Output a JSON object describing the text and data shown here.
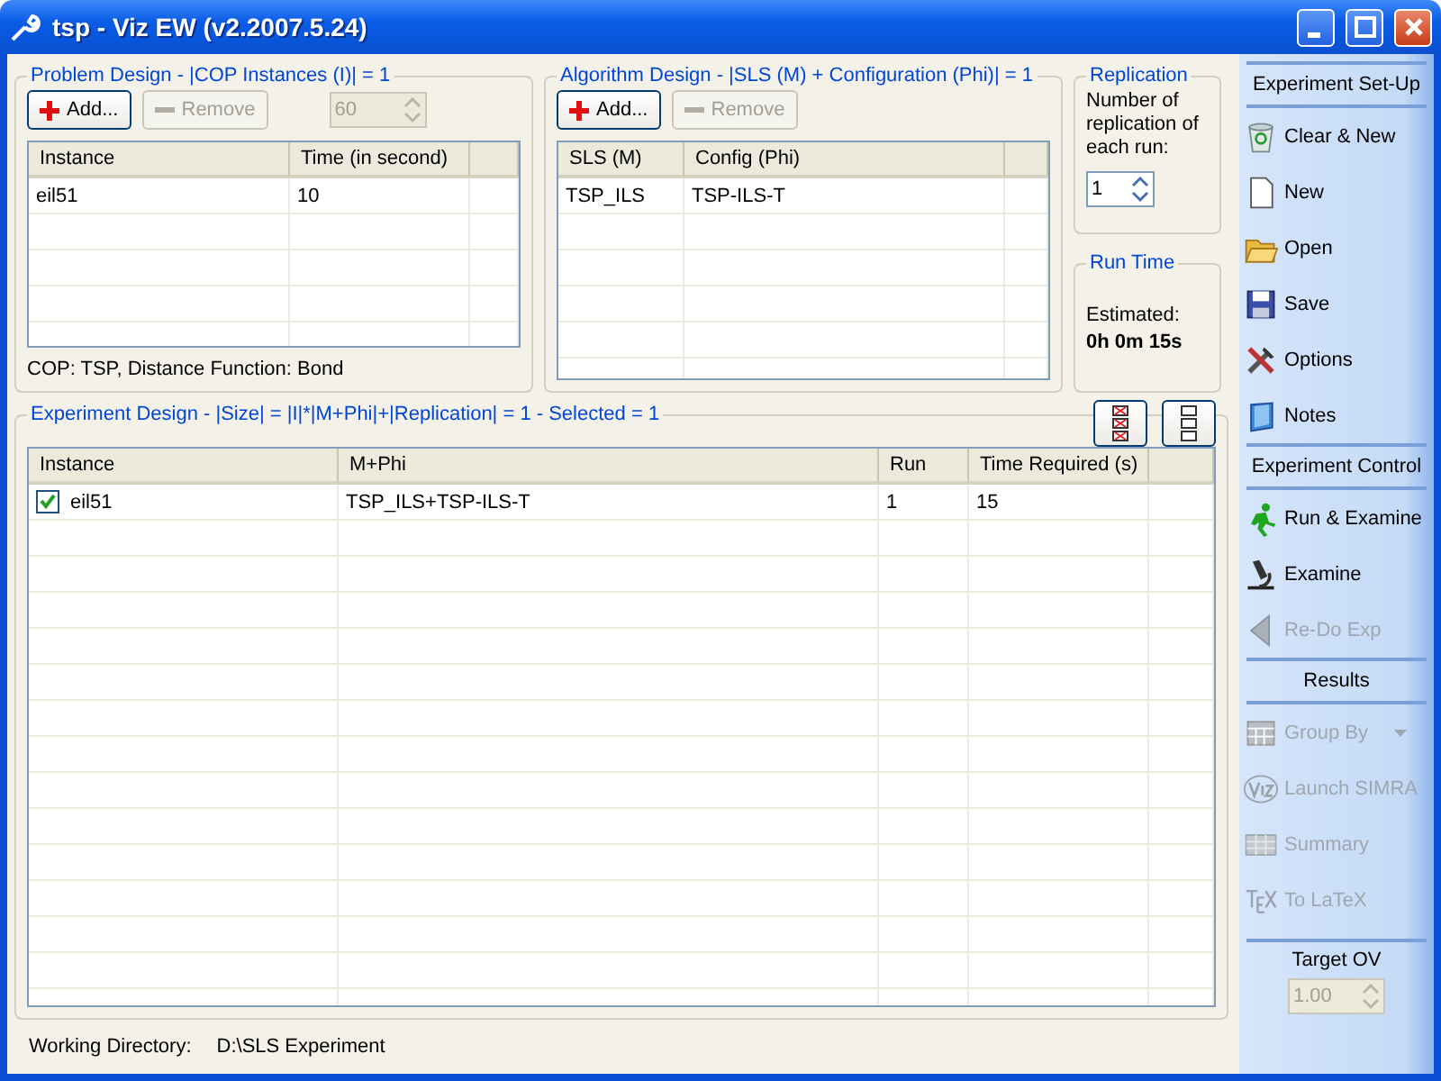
{
  "window": {
    "title": "tsp - Viz EW (v2.2007.5.24)"
  },
  "problem_design": {
    "title": "Problem Design - |COP Instances (I)| = 1",
    "add_button": "Add...",
    "remove_button": {
      "label": "Remove",
      "disabled": true
    },
    "spinner": {
      "value": "60",
      "disabled": true
    },
    "table": {
      "columns": [
        "Instance",
        "Time (in second)"
      ],
      "rows": [
        [
          "eil51",
          "10"
        ]
      ]
    },
    "info": "COP: TSP, Distance Function: Bond"
  },
  "algorithm_design": {
    "title": "Algorithm Design - |SLS (M) + Configuration (Phi)| = 1",
    "add_button": "Add...",
    "remove_button": {
      "label": "Remove",
      "disabled": true
    },
    "table": {
      "columns": [
        "SLS (M)",
        "Config (Phi)"
      ],
      "rows": [
        [
          "TSP_ILS",
          "TSP-ILS-T"
        ]
      ]
    }
  },
  "replication": {
    "title": "Replication",
    "label": "Number of replication of each run:",
    "value": "1"
  },
  "run_time": {
    "title": "Run Time",
    "label": "Estimated:",
    "value": "0h 0m 15s"
  },
  "experiment_design": {
    "title": "Experiment Design - |Size| = |I|*|M+Phi|+|Replication| = 1 - Selected = 1",
    "table": {
      "columns": [
        "Instance",
        "M+Phi",
        "Run",
        "Time Required (s)"
      ],
      "rows": [
        {
          "checked": true,
          "cells": [
            "eil51",
            "TSP_ILS+TSP-ILS-T",
            "1",
            "15"
          ]
        }
      ]
    }
  },
  "working_directory": {
    "label": "Working Directory:",
    "value": "D:\\SLS Experiment"
  },
  "sidebar": {
    "sections": [
      {
        "title": "Experiment Set-Up",
        "items": [
          {
            "label": "Clear & New",
            "disabled": false
          },
          {
            "label": "New",
            "disabled": false
          },
          {
            "label": "Open",
            "disabled": false
          },
          {
            "label": "Save",
            "disabled": false
          },
          {
            "label": "Options",
            "disabled": false
          },
          {
            "label": "Notes",
            "disabled": false
          }
        ]
      },
      {
        "title": "Experiment Control",
        "items": [
          {
            "label": "Run & Examine",
            "disabled": false
          },
          {
            "label": "Examine",
            "disabled": false
          },
          {
            "label": "Re-Do Exp",
            "disabled": true
          }
        ]
      },
      {
        "title": "Results",
        "items": [
          {
            "label": "Group By",
            "disabled": true,
            "dropdown": true
          },
          {
            "label": "Launch SIMRA",
            "disabled": true
          },
          {
            "label": "Summary",
            "disabled": true
          },
          {
            "label": "To LaTeX",
            "disabled": true
          }
        ]
      }
    ],
    "target_ov": {
      "title": "Target OV",
      "value": "1.00",
      "disabled": true
    }
  }
}
